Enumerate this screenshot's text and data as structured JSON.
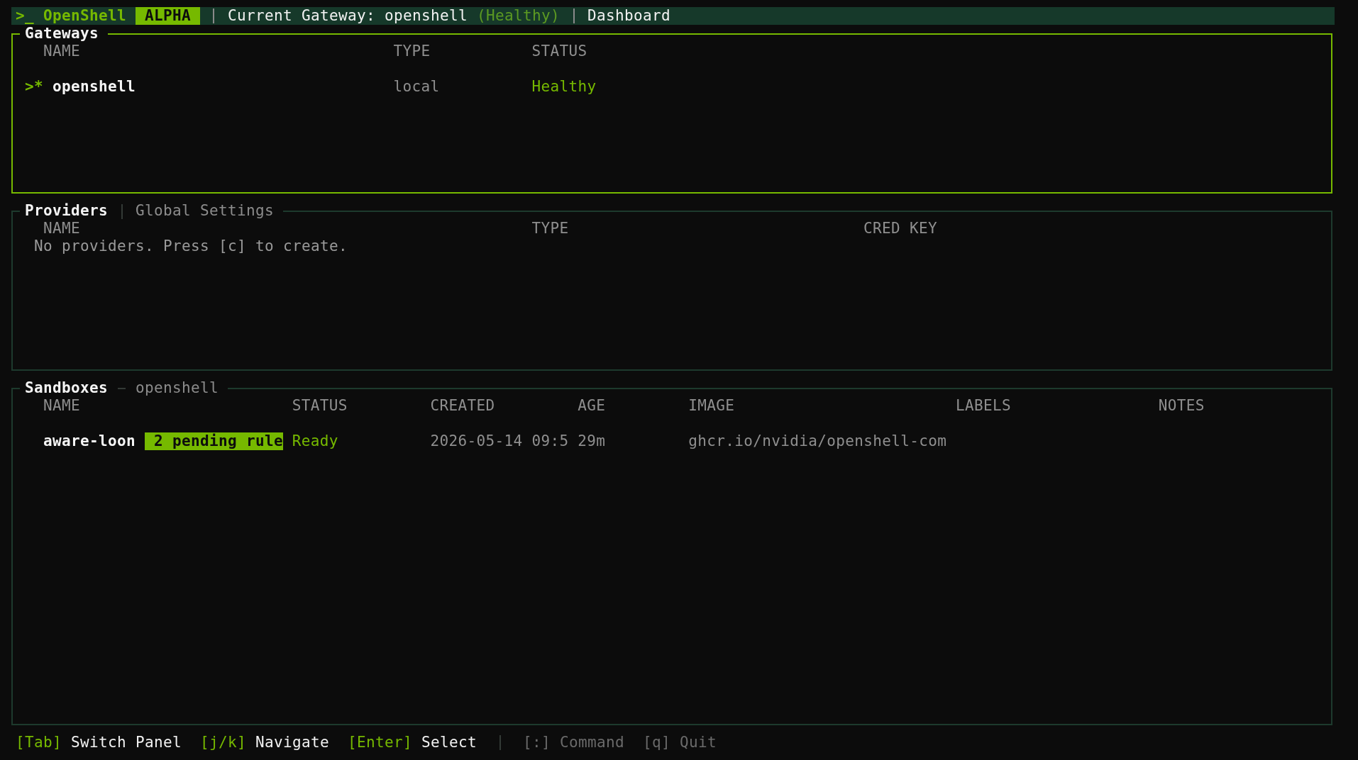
{
  "header_bar": {
    "app_title": ">_ OpenShell",
    "badge": "ALPHA",
    "gateway_label": "Current Gateway: openshell",
    "gateway_status": "(Healthy)",
    "view": "Dashboard"
  },
  "gateways_panel": {
    "title": "Gateways",
    "focused": true,
    "columns": [
      "NAME",
      "TYPE",
      "STATUS"
    ],
    "rows": [
      {
        "marker": ">*",
        "name": "openshell",
        "type": "local",
        "status": "Healthy",
        "selected": true
      }
    ]
  },
  "providers_panel": {
    "focused": false,
    "tabs": [
      {
        "label": "Providers",
        "selected": true
      },
      {
        "label": "Global Settings",
        "selected": false
      }
    ],
    "columns": [
      "NAME",
      "TYPE",
      "CRED KEY"
    ],
    "empty_message": "No providers. Press [c] to create."
  },
  "sandboxes_panel": {
    "title": "Sandboxes",
    "gateway": "openshell",
    "focused": false,
    "columns": [
      "NAME",
      "STATUS",
      "CREATED",
      "AGE",
      "IMAGE",
      "LABELS",
      "NOTES"
    ],
    "rows": [
      {
        "name": "aware-loon",
        "badge": "2 pending rule",
        "status": "Ready",
        "created": "2026-05-14 09:5",
        "age": "29m",
        "image": "ghcr.io/nvidia/openshell-com",
        "selected": false
      }
    ]
  },
  "key_hints": [
    {
      "key": "[Tab]",
      "action": "Switch Panel",
      "disabled": false
    },
    {
      "key": "[j/k]",
      "action": "Navigate",
      "disabled": false
    },
    {
      "key": "[Enter]",
      "action": "Select",
      "disabled": false
    },
    {
      "key": "[:]",
      "action": "Command",
      "disabled": true
    },
    {
      "key": "[q]",
      "action": "Quit",
      "disabled": true
    }
  ]
}
